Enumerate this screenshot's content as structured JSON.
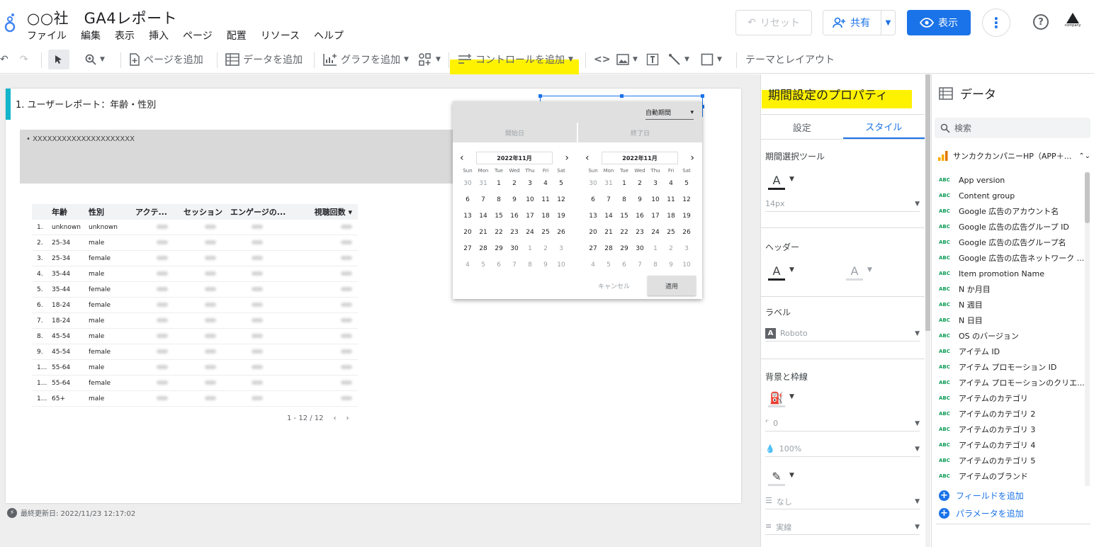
{
  "header": {
    "title": "○○社　GA4レポート",
    "menu": [
      "ファイル",
      "編集",
      "表示",
      "挿入",
      "ページ",
      "配置",
      "リソース",
      "ヘルプ"
    ],
    "reset_label": "リセット",
    "share_label": "共有",
    "view_label": "表示",
    "company_label": "company"
  },
  "toolbar": {
    "add_page": "ページを追加",
    "add_data": "データを追加",
    "add_chart": "グラフを追加",
    "add_control": "コントロールを追加",
    "theme_layout": "テーマとレイアウト"
  },
  "report": {
    "title": "1. ユーザーレポート：年齢・性別",
    "note": "• XXXXXXXXXXXXXXXXXXXXX",
    "table": {
      "headers": [
        "",
        "年齢",
        "性別",
        "アクテ...",
        "セッション",
        "エンゲージの...",
        "視聴回数 ▾"
      ],
      "rows": [
        [
          "1.",
          "unknown",
          "unknown"
        ],
        [
          "2.",
          "25-34",
          "male"
        ],
        [
          "3.",
          "25-34",
          "female"
        ],
        [
          "4.",
          "35-44",
          "male"
        ],
        [
          "5.",
          "35-44",
          "female"
        ],
        [
          "6.",
          "18-24",
          "female"
        ],
        [
          "7.",
          "18-24",
          "male"
        ],
        [
          "8.",
          "45-54",
          "male"
        ],
        [
          "9.",
          "45-54",
          "female"
        ],
        [
          "1...",
          "55-64",
          "male"
        ],
        [
          "1...",
          "55-64",
          "female"
        ],
        [
          "1...",
          "65+",
          "male"
        ]
      ]
    },
    "pager": "1 - 12 / 12",
    "last_updated": "最終更新日: 2022/11/23 12:17:02"
  },
  "datepicker": {
    "auto_period": "自動期間",
    "start_tab": "開始日",
    "end_tab": "終了日",
    "month_left": "2022年11月",
    "month_right": "2022年11月",
    "dow": [
      "Sun",
      "Mon",
      "Tue",
      "Wed",
      "Thu",
      "Fri",
      "Sat"
    ],
    "days": [
      [
        "30",
        "31",
        "1",
        "2",
        "3",
        "4",
        "5"
      ],
      [
        "6",
        "7",
        "8",
        "9",
        "10",
        "11",
        "12"
      ],
      [
        "13",
        "14",
        "15",
        "16",
        "17",
        "18",
        "19"
      ],
      [
        "20",
        "21",
        "22",
        "23",
        "24",
        "25",
        "26"
      ],
      [
        "27",
        "28",
        "29",
        "30",
        "1",
        "2",
        "3"
      ],
      [
        "4",
        "5",
        "6",
        "7",
        "8",
        "9",
        "10"
      ]
    ],
    "cancel": "キャンセル",
    "apply": "適用"
  },
  "properties": {
    "title": "期間設定のプロパティ",
    "tab_settings": "設定",
    "tab_style": "スタイル",
    "picker_tool": "期間選択ツール",
    "font_size": "14px",
    "header": "ヘッダー",
    "label": "ラベル",
    "label_font": "Roboto",
    "background_border": "背景と枠線",
    "border_radius": "0",
    "opacity": "100%",
    "border_weight": "なし",
    "border_style": "実線"
  },
  "data_panel": {
    "title": "データ",
    "search_placeholder": "検索",
    "source": "サンカクカンパニーHP（APP＋...",
    "fields": [
      "App version",
      "Content group",
      "Google 広告のアカウント名",
      "Google 広告の広告グループ ID",
      "Google 広告の広告グループ名",
      "Google 広告の広告ネットワーク ...",
      "Item promotion Name",
      "N か月目",
      "N 週目",
      "N 日目",
      "OS のバージョン",
      "アイテム ID",
      "アイテム プロモーション ID",
      "アイテム プロモーションのクリエ...",
      "アイテムのカテゴリ",
      "アイテムのカテゴリ 2",
      "アイテムのカテゴリ 3",
      "アイテムのカテゴリ 4",
      "アイテムのカテゴリ 5",
      "アイテムのブランド"
    ],
    "abc": "ABC",
    "add_field": "フィールドを追加",
    "add_param": "パラメータを追加"
  },
  "colors": {
    "accent": "#1a73e8",
    "highlight": "#fff200",
    "teal": "#12b5cb"
  }
}
